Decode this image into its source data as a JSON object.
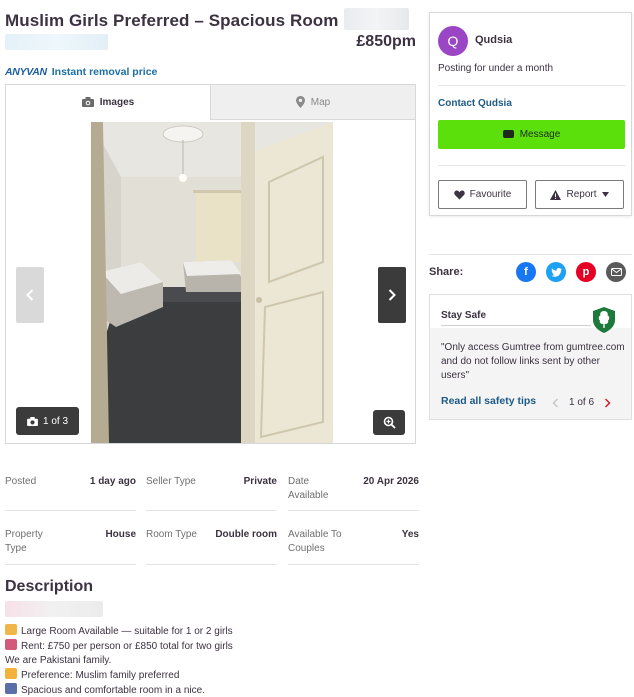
{
  "listing": {
    "title": "Muslim Girls Preferred – Spacious Room in",
    "price": "£850pm"
  },
  "anyvan": {
    "logo": "ANYVAN",
    "text": "Instant removal price"
  },
  "gallery": {
    "tab_images": "Images",
    "tab_map": "Map",
    "counter": "1 of 3"
  },
  "details": [
    {
      "label": "Posted",
      "value": "1 day ago"
    },
    {
      "label": "Seller Type",
      "value": "Private"
    },
    {
      "label": "Date Available",
      "value": "20 Apr 2026"
    },
    {
      "label": "Property Type",
      "value": "House"
    },
    {
      "label": "Room Type",
      "value": "Double room"
    },
    {
      "label": "Available To Couples",
      "value": "Yes"
    }
  ],
  "description": {
    "heading": "Description",
    "lines": [
      "Large Room Available — suitable for 1 or 2 girls",
      "Rent: £750 per person or £850 total for two girls",
      "We are Pakistani family.",
      "Preference: Muslim family preferred",
      "Spacious and comfortable room in a nice."
    ]
  },
  "seller": {
    "initial": "Q",
    "name": "Qudsia",
    "posting": "Posting for under a month",
    "contact": "Contact Qudsia",
    "message": "Message",
    "favourite": "Favourite",
    "report": "Report"
  },
  "share": {
    "label": "Share:",
    "icons": [
      "facebook-icon",
      "twitter-icon",
      "pinterest-icon",
      "email-icon"
    ]
  },
  "safety": {
    "title": "Stay Safe",
    "quote": "\"Only access Gumtree from gumtree.com and do not follow links sent by other users\"",
    "link": "Read all safety tips",
    "pager": "1 of 6"
  },
  "colors": {
    "text": "#3c3241",
    "link": "#1e5a87",
    "message_btn": "#5ce00b",
    "avatar": "#9b46c4",
    "facebook": "#1877f2",
    "twitter": "#1da1f2",
    "pinterest": "#e60023",
    "email": "#5a5a5a"
  }
}
